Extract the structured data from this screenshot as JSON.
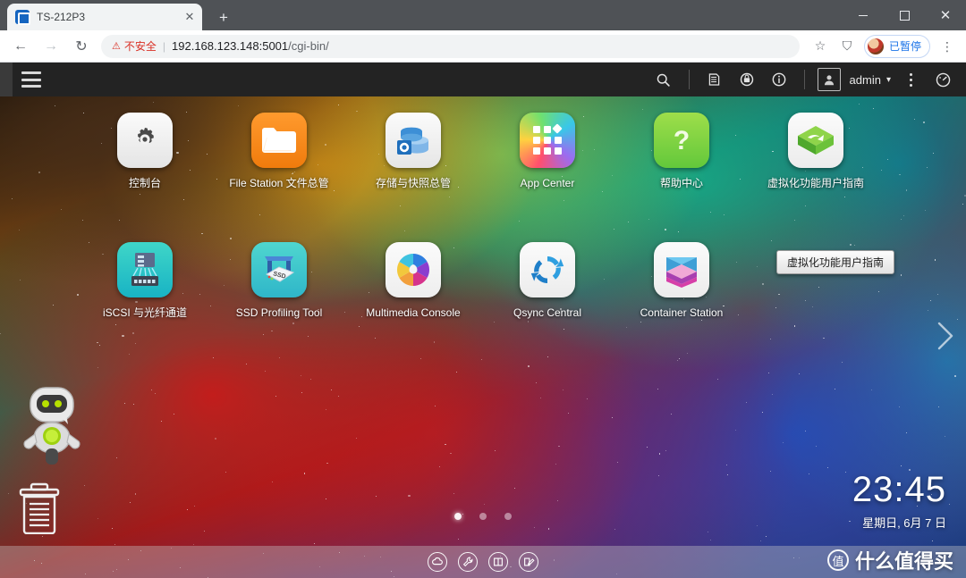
{
  "browser": {
    "tab": {
      "title": "TS-212P3",
      "favicon": "qnap-favicon",
      "close": "✕"
    },
    "new_tab": "+",
    "window": {
      "minimize": "—",
      "maximize": "□",
      "close": "✕"
    },
    "nav": {
      "back": "←",
      "forward": "→",
      "reload": "↻"
    },
    "omnibox": {
      "warning_icon": "⚠",
      "warning_text": "不安全",
      "separator": "|",
      "url_host": "192.168.123.148:5001",
      "url_path": "/cgi-bin/"
    },
    "toolbar_right": {
      "bookmark_star": "☆",
      "shield": "⛉",
      "profile_label": "已暂停",
      "menu": "⋮"
    }
  },
  "qnap_header": {
    "menu_icon": "hamburger-icon",
    "search_icon": "search-icon",
    "notification_icon": "notification-icon",
    "backup_icon": "backup-sync-icon",
    "info_icon": "info-icon",
    "user_icon": "user-avatar-icon",
    "user_label": "admin",
    "user_caret": "▾",
    "more_icon": "more-options-icon",
    "dashboard_icon": "dashboard-gauge-icon"
  },
  "desktop": {
    "tooltip": "虚拟化功能用户指南",
    "page_dots": {
      "count": 3,
      "active_index": 0
    },
    "next_page_arrow": "chevron-right-icon",
    "qboost_robot": "qboost-robot-icon",
    "recycle_bin": "recycle-bin-icon",
    "rows": [
      [
        {
          "label": "控制台",
          "icon": "control-panel-icon",
          "cls": "ic-controlpanel"
        },
        {
          "label": "File Station 文件总管",
          "icon": "file-station-icon",
          "cls": "ic-filestation"
        },
        {
          "label": "存储与快照总管",
          "icon": "storage-snapshot-icon",
          "cls": "ic-storage"
        },
        {
          "label": "App Center",
          "icon": "app-center-icon",
          "cls": "ic-appcenter"
        },
        {
          "label": "帮助中心",
          "icon": "help-center-icon",
          "cls": "ic-help"
        },
        {
          "label": "虚拟化功能用户指南",
          "icon": "virtualization-guide-icon",
          "cls": "ic-virt"
        }
      ],
      [
        {
          "label": "iSCSI 与光纤通道",
          "icon": "iscsi-fibre-channel-icon",
          "cls": "ic-iscsi"
        },
        {
          "label": "SSD Profiling Tool",
          "icon": "ssd-profiling-tool-icon",
          "cls": "ic-ssd"
        },
        {
          "label": "Multimedia Console",
          "icon": "multimedia-console-icon",
          "cls": "ic-multimedia"
        },
        {
          "label": "Qsync Central",
          "icon": "qsync-central-icon",
          "cls": "ic-qsync"
        },
        {
          "label": "Container Station",
          "icon": "container-station-icon",
          "cls": "ic-container"
        }
      ]
    ],
    "clock": {
      "time": "23:45",
      "date": "星期日, 6月 7 日"
    }
  },
  "taskbar": {
    "icons": [
      {
        "name": "cloud-icon",
        "glyph": "☁"
      },
      {
        "name": "tools-icon",
        "glyph": "🔨"
      },
      {
        "name": "panel-icon",
        "glyph": "◫"
      },
      {
        "name": "edit-icon",
        "glyph": "✎"
      }
    ],
    "watermark": {
      "badge": "值",
      "text": "什么值得买"
    }
  },
  "colors": {
    "chrome_tabstrip": "#4f5256",
    "qnap_header": "#232323",
    "warning_red": "#d93025",
    "profile_blue": "#1a73e8",
    "file_station_orange": "#f07b0c",
    "help_green": "#63c83b"
  }
}
